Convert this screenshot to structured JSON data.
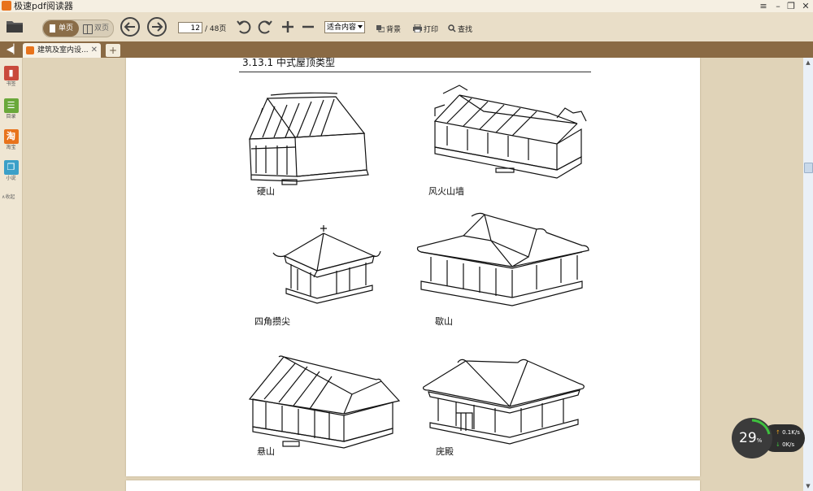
{
  "window": {
    "title": "极速pdf阅读器"
  },
  "toolbar": {
    "single_page": "单页",
    "double_page": "双页",
    "current_page": "12",
    "total_pages": "/ 48页",
    "zoom_value": "适合内容",
    "background_label": "背景",
    "print_label": "打印",
    "find_label": "查找"
  },
  "tabs": [
    {
      "label": "建筑及室内设..."
    }
  ],
  "sidebar": {
    "items": [
      {
        "label": "书签",
        "icon": "bookmark-icon",
        "color": "#c94a3c"
      },
      {
        "label": "目录",
        "icon": "toc-icon",
        "color": "#6aa83a"
      },
      {
        "label": "淘宝",
        "icon": "taobao-icon",
        "color": "#e8731c"
      },
      {
        "label": "小说",
        "icon": "book-icon",
        "color": "#3ba0c8"
      }
    ],
    "collapse_label": "收起"
  },
  "document": {
    "section_heading": "3.13.1 中式屋顶类型",
    "captions": [
      "硬山",
      "风火山墙",
      "四角攒尖",
      "歇山",
      "悬山",
      "庑殿"
    ]
  },
  "net_widget": {
    "percent": "29",
    "percent_unit": "%",
    "upload": "0.1",
    "upload_unit": "K/s",
    "download": "0",
    "download_unit": "K/s"
  },
  "colors": {
    "accent": "#e8731c",
    "toolbar_bg": "#e9dec8",
    "tabbar_bg": "#8a6a44"
  }
}
